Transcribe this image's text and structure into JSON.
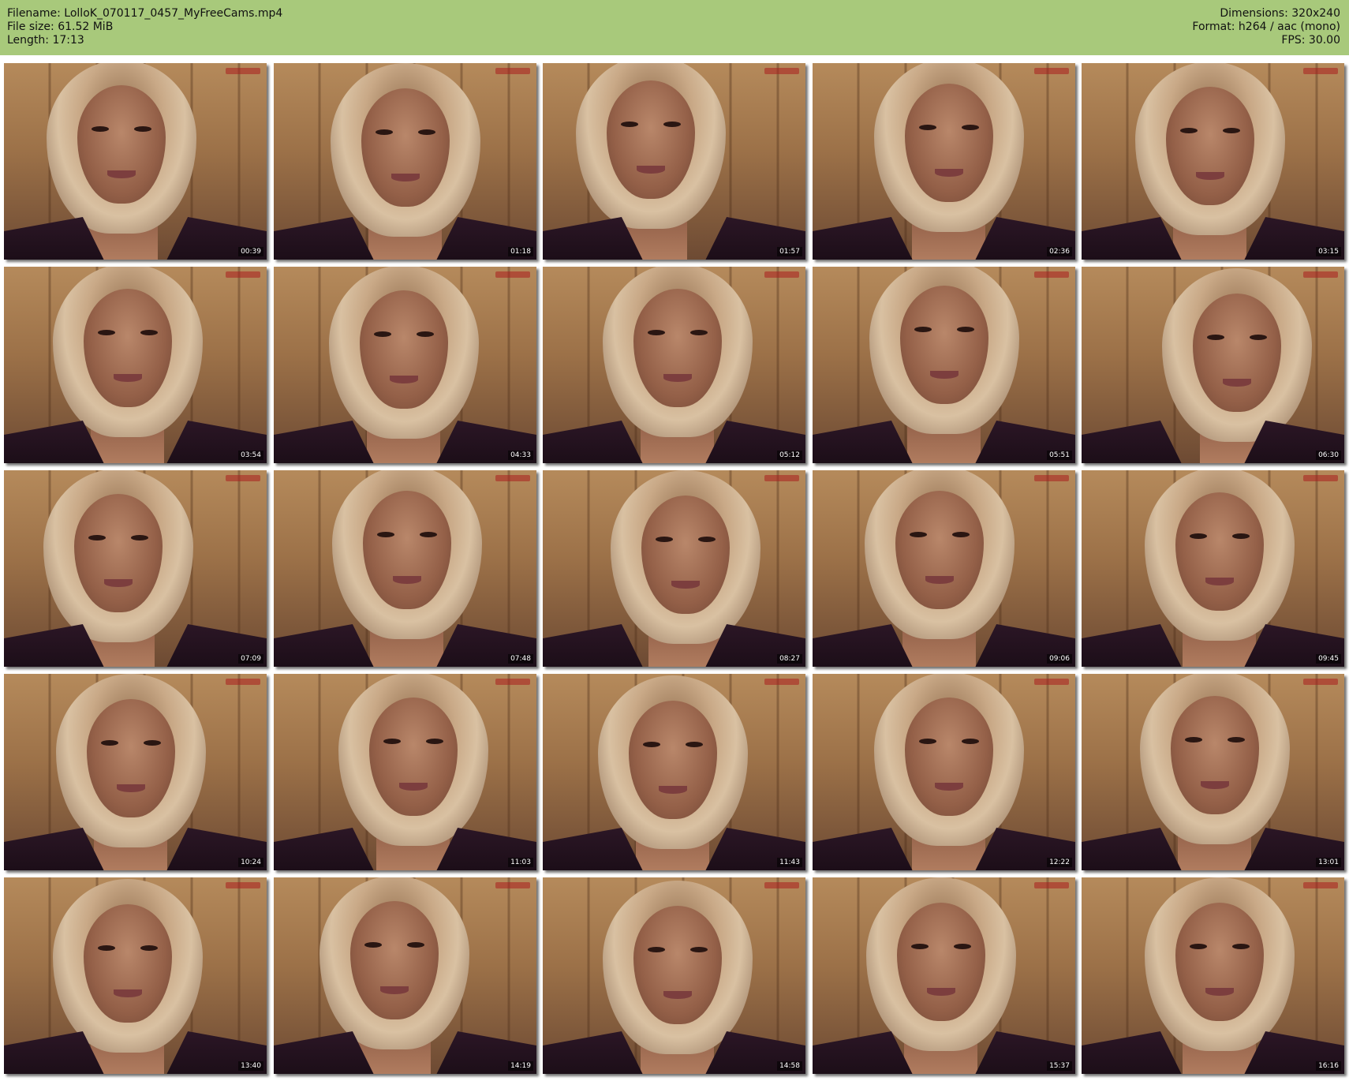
{
  "header": {
    "filename": "Filename: LolloK_070117_0457_MyFreeCams.mp4",
    "file_size": "File size: 61.52 MiB",
    "length": "Length: 17:13",
    "dimensions": "Dimensions: 320x240",
    "format": "Format: h264 / aac (mono)",
    "fps": "FPS: 30.00"
  },
  "colors": {
    "header_background": "#a8c97b",
    "page_background": "#ffffff"
  },
  "thumbnails": [
    {
      "timestamp": "00:39"
    },
    {
      "timestamp": "01:18"
    },
    {
      "timestamp": "01:57"
    },
    {
      "timestamp": "02:36"
    },
    {
      "timestamp": "03:15"
    },
    {
      "timestamp": "03:54"
    },
    {
      "timestamp": "04:33"
    },
    {
      "timestamp": "05:12"
    },
    {
      "timestamp": "05:51"
    },
    {
      "timestamp": "06:30"
    },
    {
      "timestamp": "07:09"
    },
    {
      "timestamp": "07:48"
    },
    {
      "timestamp": "08:27"
    },
    {
      "timestamp": "09:06"
    },
    {
      "timestamp": "09:45"
    },
    {
      "timestamp": "10:24"
    },
    {
      "timestamp": "11:03"
    },
    {
      "timestamp": "11:43"
    },
    {
      "timestamp": "12:22"
    },
    {
      "timestamp": "13:01"
    },
    {
      "timestamp": "13:40"
    },
    {
      "timestamp": "14:19"
    },
    {
      "timestamp": "14:58"
    },
    {
      "timestamp": "15:37"
    },
    {
      "timestamp": "16:16"
    }
  ]
}
